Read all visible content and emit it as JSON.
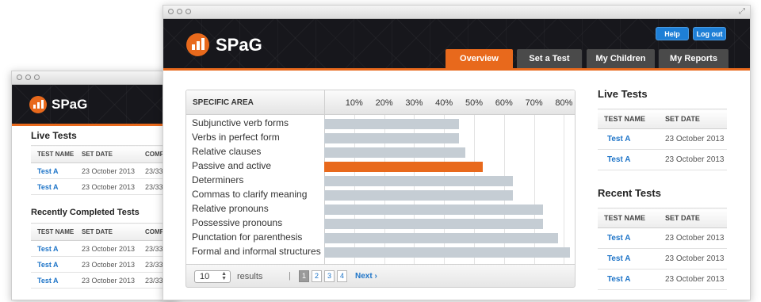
{
  "back_window": {
    "logo_text": "SPaG",
    "live_tests_title": "Live Tests",
    "live_columns": [
      "TEST NAME",
      "SET DATE",
      "COMPL"
    ],
    "live_rows": [
      {
        "name": "Test A",
        "date": "23 October 2013",
        "completed": "23/33 ("
      },
      {
        "name": "Test A",
        "date": "23 October 2013",
        "completed": "23/33 ("
      }
    ],
    "recent_title": "Recently Completed Tests",
    "recent_columns": [
      "TEST NAME",
      "SET DATE",
      "COMPL"
    ],
    "recent_rows": [
      {
        "name": "Test A",
        "date": "23 October 2013",
        "completed": "23/33 ("
      },
      {
        "name": "Test A",
        "date": "23 October 2013",
        "completed": "23/33 ("
      },
      {
        "name": "Test A",
        "date": "23 October 2013",
        "completed": "23/33 ("
      }
    ]
  },
  "front_window": {
    "logo_text": "SPaG",
    "help_label": "Help",
    "logout_label": "Log out",
    "tabs": [
      {
        "label": "Overview",
        "active": true
      },
      {
        "label": "Set a Test",
        "active": false
      },
      {
        "label": "My Children",
        "active": false
      },
      {
        "label": "My Reports",
        "active": false
      }
    ],
    "live_tests_title": "Live Tests",
    "live_columns": [
      "TEST NAME",
      "SET DATE"
    ],
    "live_rows": [
      {
        "name": "Test A",
        "date": "23 October 2013"
      },
      {
        "name": "Test A",
        "date": "23 October 2013"
      }
    ],
    "recent_title": "Recent Tests",
    "recent_columns": [
      "TEST NAME",
      "SET DATE"
    ],
    "recent_rows": [
      {
        "name": "Test A",
        "date": "23 October 2013"
      },
      {
        "name": "Test A",
        "date": "23 October 2013"
      },
      {
        "name": "Test A",
        "date": "23 October 2013"
      }
    ],
    "pager": {
      "per_page": "10",
      "results_label": "results",
      "separator": "|",
      "pages": [
        "1",
        "2",
        "3",
        "4"
      ],
      "current_page": "1",
      "next_label": "Next ›"
    }
  },
  "colors": {
    "accent": "#e8691c",
    "bar": "#c5cdd4",
    "link": "#1f75c8",
    "header": "#17171c"
  },
  "chart_data": {
    "type": "bar",
    "orientation": "horizontal",
    "area_header": "SPECIFIC AREA",
    "ticks": [
      "10%",
      "20%",
      "30%",
      "40%",
      "50%",
      "60%",
      "70%",
      "80%"
    ],
    "xlim": [
      0,
      83
    ],
    "categories": [
      "Subjunctive verb forms",
      "Verbs in perfect form",
      "Relative clauses",
      "Passive and active",
      "Determiners",
      "Commas to clarify meaning",
      "Relative pronouns",
      "Possessive pronouns",
      "Punctation for parenthesis",
      "Formal and informal structures"
    ],
    "values": [
      45,
      45,
      47,
      53,
      63,
      63,
      73,
      73,
      78,
      82
    ],
    "highlight_index": 3
  }
}
